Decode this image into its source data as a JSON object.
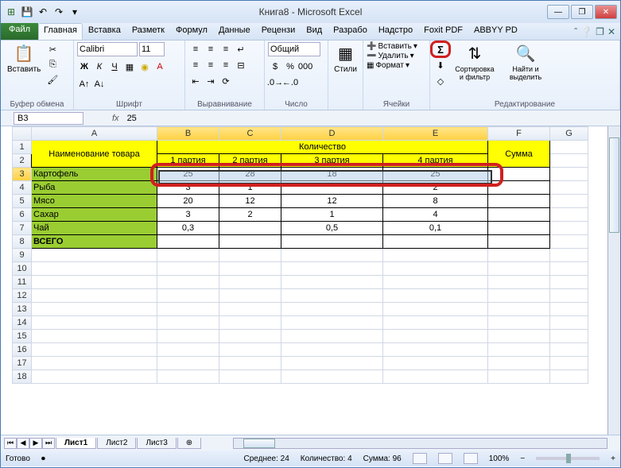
{
  "titlebar": {
    "title": "Книга8 - Microsoft Excel"
  },
  "tabs": {
    "file": "Файл",
    "items": [
      "Главная",
      "Вставка",
      "Разметк",
      "Формул",
      "Данные",
      "Рецензи",
      "Вид",
      "Разрабо",
      "Надстро",
      "Foxit PDF",
      "ABBYY PD"
    ],
    "active_index": 0
  },
  "ribbon": {
    "clipboard": {
      "paste": "Вставить",
      "label": "Буфер обмена"
    },
    "font": {
      "name": "Calibri",
      "size": "11",
      "label": "Шрифт",
      "bold": "Ж",
      "italic": "К",
      "underline": "Ч"
    },
    "alignment": {
      "label": "Выравнивание"
    },
    "number": {
      "format": "Общий",
      "label": "Число"
    },
    "styles": {
      "btn": "Стили"
    },
    "cells": {
      "insert": "Вставить",
      "delete": "Удалить",
      "format": "Формат",
      "label": "Ячейки"
    },
    "editing": {
      "sort": "Сортировка и фильтр",
      "find": "Найти и выделить",
      "label": "Редактирование",
      "autosum": "Σ"
    }
  },
  "formula_bar": {
    "name_box": "B3",
    "fx": "fx",
    "value": "25"
  },
  "columns": [
    "A",
    "B",
    "C",
    "D",
    "E",
    "F",
    "G"
  ],
  "rows_visible": 18,
  "data": {
    "header_qty": "Количество",
    "header_name": "Наименование товара",
    "header_sum": "Сумма",
    "batch": [
      "1 партия",
      "2 партия",
      "3 партия",
      "4 партия"
    ],
    "rows": [
      {
        "name": "Картофель",
        "vals": [
          "25",
          "28",
          "18",
          "25"
        ]
      },
      {
        "name": "Рыба",
        "vals": [
          "3",
          "1",
          "",
          "2"
        ]
      },
      {
        "name": "Мясо",
        "vals": [
          "20",
          "12",
          "12",
          "8"
        ]
      },
      {
        "name": "Сахар",
        "vals": [
          "3",
          "2",
          "1",
          "4"
        ]
      },
      {
        "name": "Чай",
        "vals": [
          "0,3",
          "",
          "0,5",
          "0,1"
        ]
      }
    ],
    "total_label": "ВСЕГО"
  },
  "sheets": {
    "items": [
      "Лист1",
      "Лист2",
      "Лист3"
    ],
    "active": 0
  },
  "status": {
    "ready": "Готово",
    "avg_label": "Среднее:",
    "avg": "24",
    "count_label": "Количество:",
    "count": "4",
    "sum_label": "Сумма:",
    "sum": "96",
    "zoom": "100%"
  },
  "chart_data": {
    "type": "table",
    "title": "Количество",
    "columns": [
      "Наименование товара",
      "1 партия",
      "2 партия",
      "3 партия",
      "4 партия",
      "Сумма"
    ],
    "rows": [
      [
        "Картофель",
        25,
        28,
        18,
        25,
        null
      ],
      [
        "Рыба",
        3,
        1,
        null,
        2,
        null
      ],
      [
        "Мясо",
        20,
        12,
        12,
        8,
        null
      ],
      [
        "Сахар",
        3,
        2,
        1,
        4,
        null
      ],
      [
        "Чай",
        0.3,
        null,
        0.5,
        0.1,
        null
      ],
      [
        "ВСЕГО",
        null,
        null,
        null,
        null,
        null
      ]
    ]
  }
}
